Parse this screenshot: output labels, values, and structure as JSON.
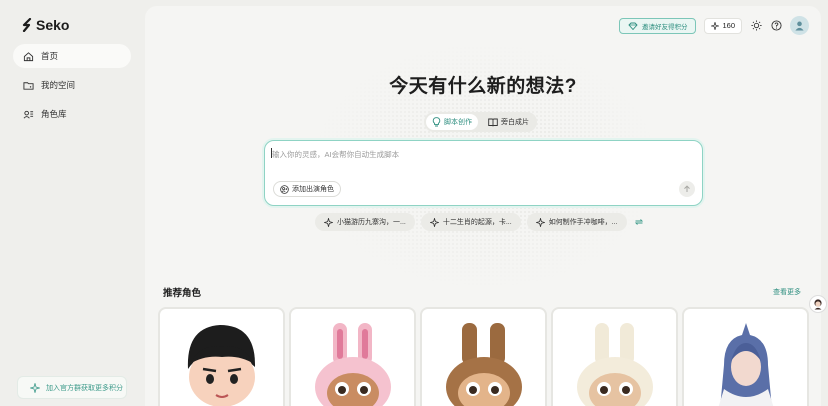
{
  "app": {
    "name": "Seko"
  },
  "sidebar": {
    "items": [
      {
        "label": "首页",
        "icon": "home-icon",
        "active": true
      },
      {
        "label": "我的空间",
        "icon": "folder-icon",
        "active": false
      },
      {
        "label": "角色库",
        "icon": "people-icon",
        "active": false
      }
    ],
    "join_label": "加入官方群获取更多积分"
  },
  "header": {
    "invite_label": "邀请好友得积分",
    "credits": "160",
    "icons": [
      "sun-icon",
      "help-icon",
      "avatar-icon"
    ]
  },
  "hero": {
    "headline": "今天有什么新的想法?",
    "modes": [
      {
        "label": "脚本创作",
        "icon": "bulb-icon",
        "active": true
      },
      {
        "label": "旁白成片",
        "icon": "book-icon",
        "active": false
      }
    ],
    "input": {
      "placeholder": "输入你的灵感，AI会帮你自动生成脚本",
      "value": ""
    },
    "add_role_label": "添加出演角色"
  },
  "suggestions": [
    "小猫游历九寨沟，一...",
    "十二生肖的起源，卡...",
    "如何制作手冲咖啡，..."
  ],
  "recommend": {
    "title": "推荐角色",
    "more_label": "查看更多",
    "cards": [
      {
        "name": "boy-character"
      },
      {
        "name": "pink-bunny-character"
      },
      {
        "name": "brown-bunny-character"
      },
      {
        "name": "white-bunny-character"
      },
      {
        "name": "elf-character"
      }
    ]
  },
  "colors": {
    "accent": "#2f8f80",
    "background": "#efefec",
    "panel": "#f5f5f3"
  }
}
